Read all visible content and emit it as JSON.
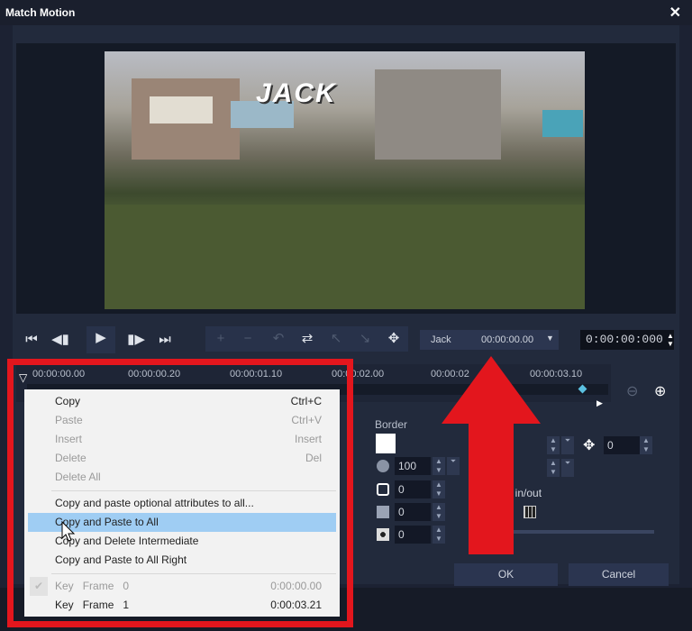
{
  "window": {
    "title": "Match Motion",
    "close_icon": "close-icon"
  },
  "video": {
    "overlay_title": "JACK"
  },
  "transport": {
    "buttons": [
      "go-to-start",
      "previous-frame",
      "play",
      "next-frame",
      "go-to-end"
    ]
  },
  "object_selector": {
    "name": "Jack",
    "time": "00:00:00.00"
  },
  "timecode": "0:00:00:000",
  "ruler": {
    "ticks": [
      "00:00:00.00",
      "00:00:00.20",
      "00:00:01.10",
      "00:00:02.00",
      "00:00:02",
      "00:00:03.10"
    ]
  },
  "border": {
    "label": "Border",
    "color": "#ffffff",
    "opacity": "100",
    "values": [
      "0",
      "0",
      "0"
    ]
  },
  "position": {
    "value": "0"
  },
  "ease": {
    "label": "Ease in/out"
  },
  "buttons": {
    "ok": "OK",
    "cancel": "Cancel"
  },
  "context_menu": {
    "items": [
      {
        "label": "Copy",
        "shortcut": "Ctrl+C",
        "enabled": true
      },
      {
        "label": "Paste",
        "shortcut": "Ctrl+V",
        "enabled": false
      },
      {
        "label": "Insert",
        "shortcut": "Insert",
        "enabled": false
      },
      {
        "label": "Delete",
        "shortcut": "Del",
        "enabled": false
      },
      {
        "label": "Delete All",
        "shortcut": "",
        "enabled": false
      }
    ],
    "items2": [
      {
        "label": "Copy and paste optional attributes to all..."
      },
      {
        "label": "Copy and Paste to All",
        "highlighted": true
      },
      {
        "label": "Copy and Delete Intermediate"
      },
      {
        "label": "Copy and Paste to All Right"
      }
    ],
    "keyframes": [
      {
        "key": "Key",
        "frame": "Frame",
        "num": "0",
        "time": "0:00:00.00",
        "checked": true
      },
      {
        "key": "Key",
        "frame": "Frame",
        "num": "1",
        "time": "0:00:03.21",
        "checked": false
      }
    ]
  },
  "colors": {
    "annotation": "#e3161d",
    "highlight": "#9fcdf3",
    "background": "#1c2233"
  }
}
